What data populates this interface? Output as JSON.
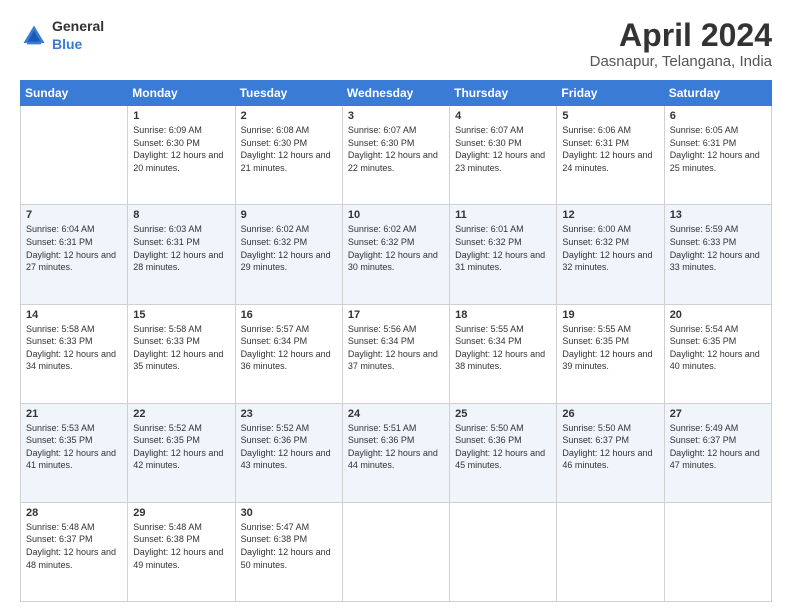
{
  "header": {
    "logo_general": "General",
    "logo_blue": "Blue",
    "month_year": "April 2024",
    "location": "Dasnapur, Telangana, India"
  },
  "weekdays": [
    "Sunday",
    "Monday",
    "Tuesday",
    "Wednesday",
    "Thursday",
    "Friday",
    "Saturday"
  ],
  "weeks": [
    [
      {
        "day": "",
        "sunrise": "",
        "sunset": "",
        "daylight": ""
      },
      {
        "day": "1",
        "sunrise": "Sunrise: 6:09 AM",
        "sunset": "Sunset: 6:30 PM",
        "daylight": "Daylight: 12 hours and 20 minutes."
      },
      {
        "day": "2",
        "sunrise": "Sunrise: 6:08 AM",
        "sunset": "Sunset: 6:30 PM",
        "daylight": "Daylight: 12 hours and 21 minutes."
      },
      {
        "day": "3",
        "sunrise": "Sunrise: 6:07 AM",
        "sunset": "Sunset: 6:30 PM",
        "daylight": "Daylight: 12 hours and 22 minutes."
      },
      {
        "day": "4",
        "sunrise": "Sunrise: 6:07 AM",
        "sunset": "Sunset: 6:30 PM",
        "daylight": "Daylight: 12 hours and 23 minutes."
      },
      {
        "day": "5",
        "sunrise": "Sunrise: 6:06 AM",
        "sunset": "Sunset: 6:31 PM",
        "daylight": "Daylight: 12 hours and 24 minutes."
      },
      {
        "day": "6",
        "sunrise": "Sunrise: 6:05 AM",
        "sunset": "Sunset: 6:31 PM",
        "daylight": "Daylight: 12 hours and 25 minutes."
      }
    ],
    [
      {
        "day": "7",
        "sunrise": "Sunrise: 6:04 AM",
        "sunset": "Sunset: 6:31 PM",
        "daylight": "Daylight: 12 hours and 27 minutes."
      },
      {
        "day": "8",
        "sunrise": "Sunrise: 6:03 AM",
        "sunset": "Sunset: 6:31 PM",
        "daylight": "Daylight: 12 hours and 28 minutes."
      },
      {
        "day": "9",
        "sunrise": "Sunrise: 6:02 AM",
        "sunset": "Sunset: 6:32 PM",
        "daylight": "Daylight: 12 hours and 29 minutes."
      },
      {
        "day": "10",
        "sunrise": "Sunrise: 6:02 AM",
        "sunset": "Sunset: 6:32 PM",
        "daylight": "Daylight: 12 hours and 30 minutes."
      },
      {
        "day": "11",
        "sunrise": "Sunrise: 6:01 AM",
        "sunset": "Sunset: 6:32 PM",
        "daylight": "Daylight: 12 hours and 31 minutes."
      },
      {
        "day": "12",
        "sunrise": "Sunrise: 6:00 AM",
        "sunset": "Sunset: 6:32 PM",
        "daylight": "Daylight: 12 hours and 32 minutes."
      },
      {
        "day": "13",
        "sunrise": "Sunrise: 5:59 AM",
        "sunset": "Sunset: 6:33 PM",
        "daylight": "Daylight: 12 hours and 33 minutes."
      }
    ],
    [
      {
        "day": "14",
        "sunrise": "Sunrise: 5:58 AM",
        "sunset": "Sunset: 6:33 PM",
        "daylight": "Daylight: 12 hours and 34 minutes."
      },
      {
        "day": "15",
        "sunrise": "Sunrise: 5:58 AM",
        "sunset": "Sunset: 6:33 PM",
        "daylight": "Daylight: 12 hours and 35 minutes."
      },
      {
        "day": "16",
        "sunrise": "Sunrise: 5:57 AM",
        "sunset": "Sunset: 6:34 PM",
        "daylight": "Daylight: 12 hours and 36 minutes."
      },
      {
        "day": "17",
        "sunrise": "Sunrise: 5:56 AM",
        "sunset": "Sunset: 6:34 PM",
        "daylight": "Daylight: 12 hours and 37 minutes."
      },
      {
        "day": "18",
        "sunrise": "Sunrise: 5:55 AM",
        "sunset": "Sunset: 6:34 PM",
        "daylight": "Daylight: 12 hours and 38 minutes."
      },
      {
        "day": "19",
        "sunrise": "Sunrise: 5:55 AM",
        "sunset": "Sunset: 6:35 PM",
        "daylight": "Daylight: 12 hours and 39 minutes."
      },
      {
        "day": "20",
        "sunrise": "Sunrise: 5:54 AM",
        "sunset": "Sunset: 6:35 PM",
        "daylight": "Daylight: 12 hours and 40 minutes."
      }
    ],
    [
      {
        "day": "21",
        "sunrise": "Sunrise: 5:53 AM",
        "sunset": "Sunset: 6:35 PM",
        "daylight": "Daylight: 12 hours and 41 minutes."
      },
      {
        "day": "22",
        "sunrise": "Sunrise: 5:52 AM",
        "sunset": "Sunset: 6:35 PM",
        "daylight": "Daylight: 12 hours and 42 minutes."
      },
      {
        "day": "23",
        "sunrise": "Sunrise: 5:52 AM",
        "sunset": "Sunset: 6:36 PM",
        "daylight": "Daylight: 12 hours and 43 minutes."
      },
      {
        "day": "24",
        "sunrise": "Sunrise: 5:51 AM",
        "sunset": "Sunset: 6:36 PM",
        "daylight": "Daylight: 12 hours and 44 minutes."
      },
      {
        "day": "25",
        "sunrise": "Sunrise: 5:50 AM",
        "sunset": "Sunset: 6:36 PM",
        "daylight": "Daylight: 12 hours and 45 minutes."
      },
      {
        "day": "26",
        "sunrise": "Sunrise: 5:50 AM",
        "sunset": "Sunset: 6:37 PM",
        "daylight": "Daylight: 12 hours and 46 minutes."
      },
      {
        "day": "27",
        "sunrise": "Sunrise: 5:49 AM",
        "sunset": "Sunset: 6:37 PM",
        "daylight": "Daylight: 12 hours and 47 minutes."
      }
    ],
    [
      {
        "day": "28",
        "sunrise": "Sunrise: 5:48 AM",
        "sunset": "Sunset: 6:37 PM",
        "daylight": "Daylight: 12 hours and 48 minutes."
      },
      {
        "day": "29",
        "sunrise": "Sunrise: 5:48 AM",
        "sunset": "Sunset: 6:38 PM",
        "daylight": "Daylight: 12 hours and 49 minutes."
      },
      {
        "day": "30",
        "sunrise": "Sunrise: 5:47 AM",
        "sunset": "Sunset: 6:38 PM",
        "daylight": "Daylight: 12 hours and 50 minutes."
      },
      {
        "day": "",
        "sunrise": "",
        "sunset": "",
        "daylight": ""
      },
      {
        "day": "",
        "sunrise": "",
        "sunset": "",
        "daylight": ""
      },
      {
        "day": "",
        "sunrise": "",
        "sunset": "",
        "daylight": ""
      },
      {
        "day": "",
        "sunrise": "",
        "sunset": "",
        "daylight": ""
      }
    ]
  ]
}
